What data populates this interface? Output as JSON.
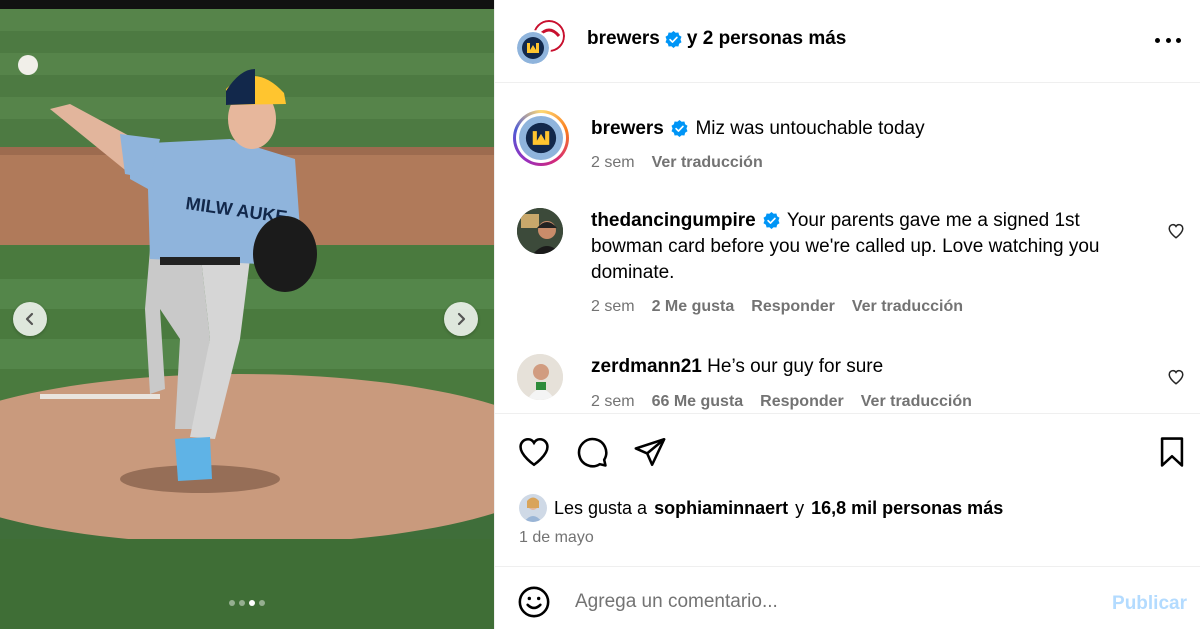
{
  "post_header": {
    "username": "brewers",
    "collab_text": "y 2 personas más"
  },
  "caption": {
    "username": "brewers",
    "text": "Miz was untouchable today",
    "time": "2 sem",
    "translate": "Ver traducción"
  },
  "comments": [
    {
      "username": "thedancingumpire",
      "verified": true,
      "text": "Your parents gave me a signed 1st bowman card before you we're called up. Love watching you dominate.",
      "time": "2 sem",
      "likes": "2 Me gusta",
      "reply": "Responder",
      "translate": "Ver traducción"
    },
    {
      "username": "zerdmann21",
      "verified": false,
      "text": "He’s our guy for sure",
      "time": "2 sem",
      "likes": "66 Me gusta",
      "reply": "Responder",
      "translate": "Ver traducción"
    }
  ],
  "likes_summary": {
    "prefix": "Les gusta a",
    "user": "sophiaminnaert",
    "connector": "y",
    "others": "16,8 mil personas más"
  },
  "post_date": "1 de mayo",
  "add_comment": {
    "placeholder": "Agrega un comentario...",
    "publish_label": "Publicar"
  },
  "carousel": {
    "slide_count": 4,
    "active_slide": 3
  },
  "colors": {
    "verified_blue": "#0095f6",
    "publish_disabled": "#b3dbff",
    "secondary_text": "#737373",
    "brewers_navy": "#12284b",
    "brewers_gold": "#ffc52f",
    "jersey_blue": "#8fb4dc"
  }
}
